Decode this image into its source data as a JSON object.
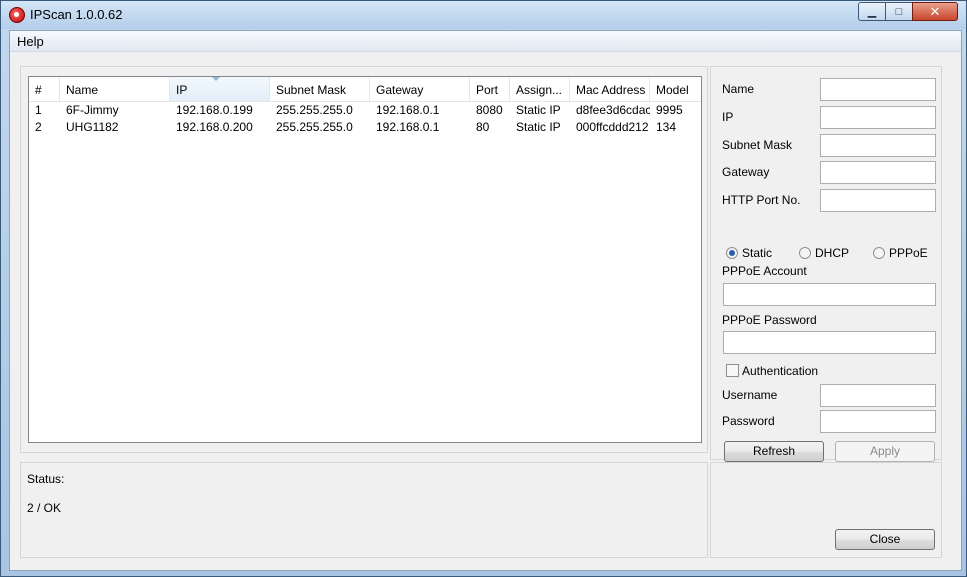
{
  "window": {
    "title": "IPScan 1.0.0.62",
    "controls": {
      "min": "▁",
      "max": "□",
      "close": "✕"
    }
  },
  "menu": {
    "items": [
      "Help"
    ]
  },
  "table": {
    "columns": [
      "#",
      "Name",
      "IP",
      "Subnet Mask",
      "Gateway",
      "Port",
      "Assign...",
      "Mac Address",
      "Model"
    ],
    "sorted_column": "IP",
    "rows": [
      [
        "1",
        "6F-Jimmy",
        "192.168.0.199",
        "255.255.255.0",
        "192.168.0.1",
        "8080",
        "Static IP",
        "d8fee3d6cdac",
        "9995"
      ],
      [
        "2",
        "UHG1182",
        "192.168.0.200",
        "255.255.255.0",
        "192.168.0.1",
        "80",
        "Static IP",
        "000ffcddd212",
        "134"
      ]
    ]
  },
  "settings": {
    "name_label": "Name",
    "name_value": "",
    "ip_label": "IP",
    "ip_value": "",
    "subnet_label": "Subnet Mask",
    "subnet_value": "",
    "gateway_label": "Gateway",
    "gateway_value": "",
    "http_port_label": "HTTP Port No.",
    "http_port_value": "",
    "mode_options": {
      "static": "Static",
      "dhcp": "DHCP",
      "pppoe": "PPPoE"
    },
    "mode_selected": "Static",
    "pppoe_account_label": "PPPoE Account",
    "pppoe_account_value": "",
    "pppoe_password_label": "PPPoE Password",
    "pppoe_password_value": "",
    "authentication_label": "Authentication",
    "authentication_checked": false,
    "username_label": "Username",
    "username_value": "",
    "password_label": "Password",
    "password_value": "",
    "refresh_label": "Refresh",
    "apply_label": "Apply"
  },
  "status": {
    "label": "Status:",
    "value": "2 / OK"
  },
  "close_label": "Close"
}
